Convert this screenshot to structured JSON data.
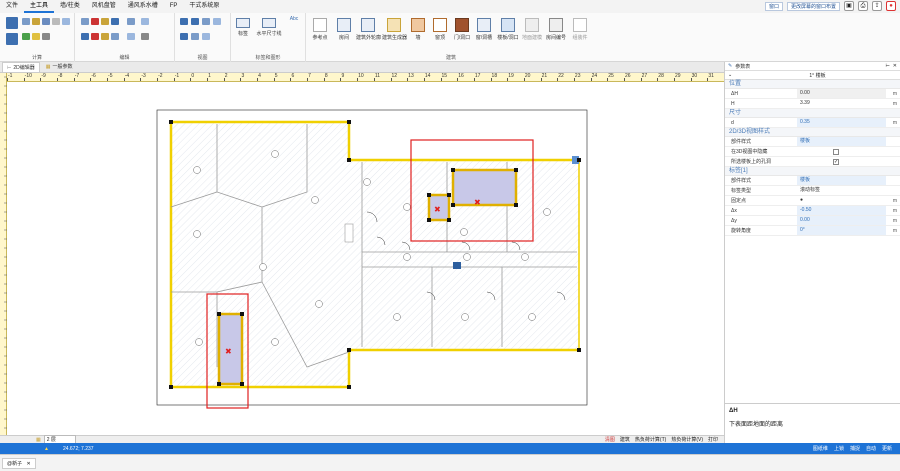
{
  "menu": {
    "items": [
      "文件",
      "主工具",
      "墙/柱类",
      "风机盘管",
      "通风系水槽",
      "FP",
      "干式系统原"
    ],
    "active_index": 1,
    "window_select": "窗口",
    "layout_select": "更改屏幕的窗口布置"
  },
  "ribbon": {
    "groups": [
      "计算",
      "编辑",
      "视图",
      "标签和图形",
      "建筑"
    ],
    "buttons": [
      "参考点",
      "房间",
      "建筑外轮廓",
      "建筑生成器",
      "墙",
      "窗顶",
      "门/洞口",
      "窗/洞槽",
      "楼板/洞口",
      "地面建模",
      "房间编号",
      "组装件"
    ],
    "label_tools": [
      "标签",
      "水平尺寸线",
      "Abc"
    ]
  },
  "tabs": [
    {
      "label": "2D编辑器"
    },
    {
      "label": "一般参数"
    }
  ],
  "ruler_h": [
    "-1",
    "-10",
    "-9",
    "-8",
    "-7",
    "-6",
    "-5",
    "-4",
    "-3",
    "-2",
    "-1",
    "0",
    "1",
    "2",
    "3",
    "4",
    "5",
    "6",
    "7",
    "8",
    "9",
    "10",
    "11",
    "12",
    "13",
    "14",
    "15",
    "16",
    "17",
    "18",
    "19",
    "20",
    "21",
    "22",
    "23",
    "24",
    "25",
    "26",
    "27",
    "28",
    "29",
    "30",
    "31"
  ],
  "panel": {
    "title": "参数表",
    "selection": "1° 楼板",
    "sections": [
      {
        "title": "位置",
        "rows": [
          {
            "name": "ΔH",
            "value": "0.00",
            "unit": "m",
            "style": "gray"
          },
          {
            "name": "H",
            "value": "3.39",
            "unit": "m",
            "style": "plain"
          }
        ]
      },
      {
        "title": "尺寸",
        "rows": [
          {
            "name": "d",
            "value": "0.35",
            "unit": "m",
            "style": "blue"
          }
        ]
      },
      {
        "title": "2D/3D视图样式",
        "rows": [
          {
            "name": "部件样式",
            "value": "楼板",
            "unit": "",
            "style": "blue"
          },
          {
            "name": "在3D视图中隐藏",
            "value": "",
            "unit": "",
            "style": "check",
            "checked": ""
          },
          {
            "name": "所选楼板上的孔洞",
            "value": "",
            "unit": "",
            "style": "check",
            "checked": "✓"
          }
        ]
      },
      {
        "title": "标签[1]",
        "rows": [
          {
            "name": "部件样式",
            "value": "楼板",
            "unit": "",
            "style": "blue"
          },
          {
            "name": "标签类型",
            "value": "滚动标签",
            "unit": "",
            "style": "plain"
          },
          {
            "name": "固定点",
            "value": "●",
            "unit": "m",
            "style": "plain"
          },
          {
            "name": "Δx",
            "value": "-0.50",
            "unit": "m",
            "style": "blue"
          },
          {
            "name": "Δy",
            "value": "0.00",
            "unit": "m",
            "style": "blue"
          },
          {
            "name": "旋转角度",
            "value": "0°",
            "unit": "m",
            "style": "blue"
          }
        ]
      }
    ],
    "help_title": "ΔH",
    "help_text": "下表面距地面的距离"
  },
  "bottom_toolbar": {
    "floor": "2 层",
    "items": [
      "清图",
      "建筑",
      "热负荷计算(T)",
      "热负荷计算(V)",
      "打印"
    ]
  },
  "status": {
    "coords": "24.672; 7.237",
    "right_items": [
      "图纸维",
      "上锁",
      "捕捉",
      "自动",
      "更新"
    ]
  },
  "doc_tab": "@新子"
}
